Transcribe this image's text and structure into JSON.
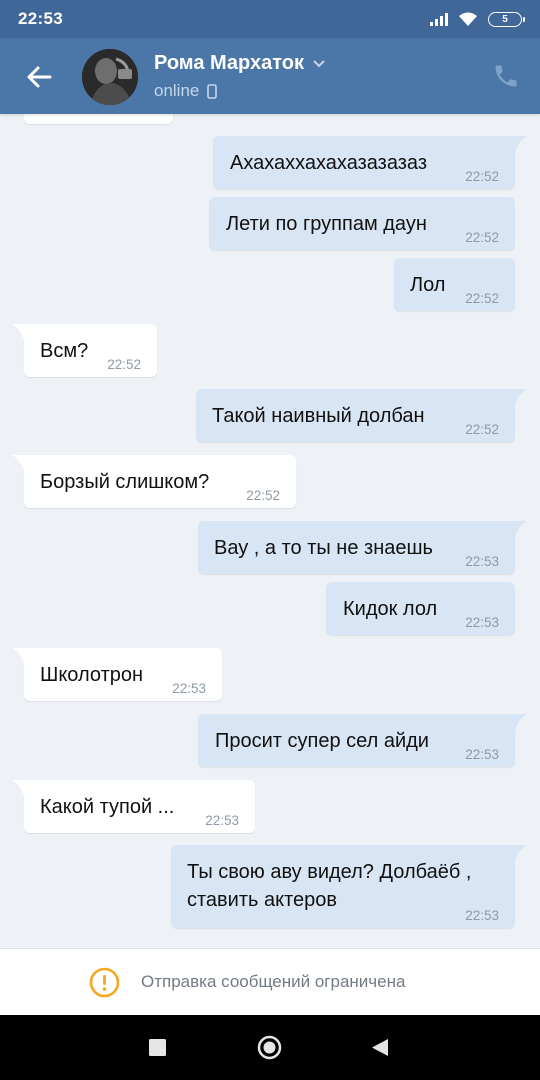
{
  "status_bar": {
    "time": "22:53",
    "battery": "5"
  },
  "header": {
    "contact_name": "Рома Мархаток",
    "status": "online"
  },
  "messages": [
    {
      "text": "Ахахаххахахазазазаз",
      "time": "22:52",
      "direction": "out"
    },
    {
      "text": "Лети по группам даун",
      "time": "22:52",
      "direction": "out"
    },
    {
      "text": "Лол",
      "time": "22:52",
      "direction": "out"
    },
    {
      "text": "Всм?",
      "time": "22:52",
      "direction": "in"
    },
    {
      "text": "Такой наивный долбан",
      "time": "22:52",
      "direction": "out"
    },
    {
      "text": "Борзый слишком?",
      "time": "22:52",
      "direction": "in"
    },
    {
      "text": "Вау , а то ты не знаешь",
      "time": "22:53",
      "direction": "out"
    },
    {
      "text": "Кидок лол",
      "time": "22:53",
      "direction": "out"
    },
    {
      "text": "Школотрон",
      "time": "22:53",
      "direction": "in"
    },
    {
      "text": "Просит супер сел айди",
      "time": "22:53",
      "direction": "out"
    },
    {
      "text": "Какой тупой ...",
      "time": "22:53",
      "direction": "in"
    },
    {
      "text": "Ты свою аву видел? Долбаёб ,\nставить актеров",
      "time": "22:53",
      "direction": "out"
    }
  ],
  "footer": {
    "notice": "Отправка сообщений ограничена"
  },
  "colors": {
    "header": "#4a76a8",
    "status_bar": "#3f6797",
    "chat_background": "#eef1f5",
    "outgoing_bubble": "#d8e5f4",
    "incoming_bubble": "#ffffff",
    "warning": "#f5a623"
  }
}
